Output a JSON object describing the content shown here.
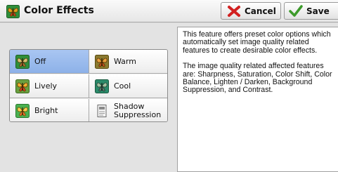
{
  "header": {
    "title": "Color Effects",
    "cancel_label": "Cancel",
    "save_label": "Save"
  },
  "options": [
    {
      "label": "Off",
      "icon": "butterfly-icon",
      "selected": true
    },
    {
      "label": "Warm",
      "icon": "butterfly-icon",
      "selected": false
    },
    {
      "label": "Lively",
      "icon": "butterfly-icon",
      "selected": false
    },
    {
      "label": "Cool",
      "icon": "butterfly-icon",
      "selected": false
    },
    {
      "label": "Bright",
      "icon": "butterfly-icon",
      "selected": false
    },
    {
      "label": "Shadow Suppression",
      "icon": "document-icon",
      "selected": false
    }
  ],
  "description": {
    "para1": "This feature offers preset color options which automatically set image quality related features to create desirable color effects.",
    "para2": "The image quality related affected features are: Sharpness, Saturation, Color Shift, Color Balance, Lighten / Darken, Background Suppression, and Contrast."
  },
  "colors": {
    "selected": "#9dbcee",
    "cancel_icon": "#d22020",
    "save_icon": "#3c9a2a",
    "icon_green": "#2e8b2e"
  }
}
